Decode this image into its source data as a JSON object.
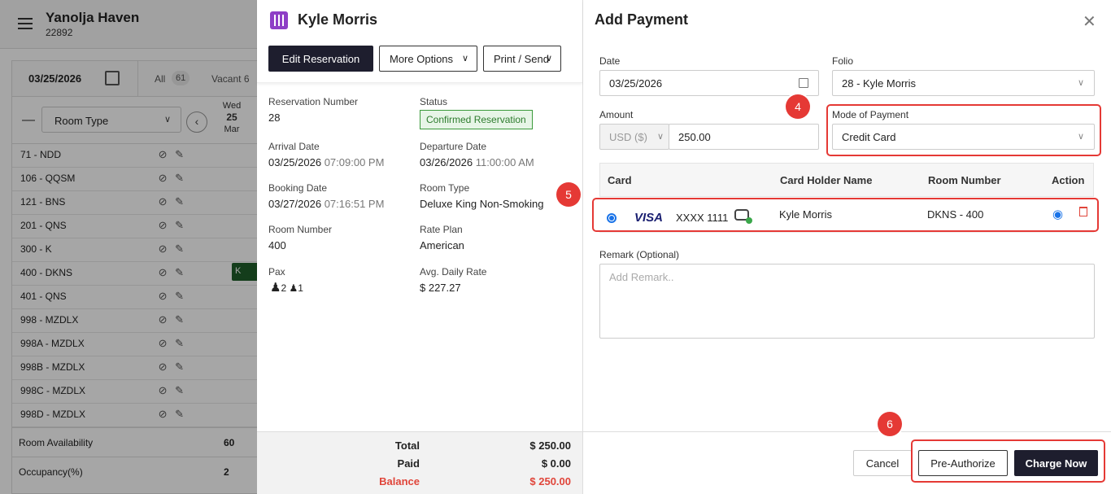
{
  "app": {
    "hotel_name": "Yanolja Haven",
    "hotel_id": "22892"
  },
  "grid": {
    "date": "03/25/2026",
    "all_label": "All",
    "all_count": "61",
    "vacant_label": "Vacant",
    "vacant_count": "6",
    "room_type_label": "Room Type",
    "day": {
      "weekday": "Wed",
      "date": "25",
      "month": "Mar"
    },
    "rooms": [
      "71 - NDD",
      "106 - QQSM",
      "121 - BNS",
      "201 - QNS",
      "300 - K",
      "400 - DKNS",
      "401 - QNS",
      "998 - MZDLX",
      "998A - MZDLX",
      "998B - MZDLX",
      "998C - MZDLX",
      "998D - MZDLX"
    ],
    "block_label": "K",
    "availability_label": "Room Availability",
    "availability_value": "60",
    "occupancy_label": "Occupancy(%)",
    "occupancy_value": "2"
  },
  "reservation": {
    "guest_name": "Kyle Morris",
    "edit_label": "Edit Reservation",
    "more_options_label": "More Options",
    "print_send_label": "Print / Send",
    "number_label": "Reservation Number",
    "number": "28",
    "status_label": "Status",
    "status": "Confirmed Reservation",
    "arrival_label": "Arrival Date",
    "arrival_date": "03/25/2026",
    "arrival_time": "07:09:00 PM",
    "departure_label": "Departure Date",
    "departure_date": "03/26/2026",
    "departure_time": "11:00:00 AM",
    "booking_label": "Booking Date",
    "booking_date": "03/27/2026",
    "booking_time": "07:16:51 PM",
    "room_type_label": "Room Type",
    "room_type": "Deluxe King Non-Smoking",
    "room_number_label": "Room Number",
    "room_number": "400",
    "rate_plan_label": "Rate Plan",
    "rate_plan": "American",
    "pax_label": "Pax",
    "adults": "2",
    "children": "1",
    "adr_label": "Avg. Daily Rate",
    "adr": "$ 227.27",
    "total_label": "Total",
    "total": "$ 250.00",
    "paid_label": "Paid",
    "paid": "$ 0.00",
    "balance_label": "Balance",
    "balance": "$ 250.00"
  },
  "payment": {
    "title": "Add Payment",
    "date_label": "Date",
    "date": "03/25/2026",
    "folio_label": "Folio",
    "folio": "28 - Kyle Morris",
    "amount_label": "Amount",
    "currency": "USD ($)",
    "amount": "250.00",
    "mode_label": "Mode of Payment",
    "mode": "Credit Card",
    "columns": {
      "card": "Card",
      "holder": "Card Holder Name",
      "room": "Room Number",
      "action": "Action"
    },
    "card": {
      "brand": "VISA",
      "number": "XXXX 1111",
      "holder": "Kyle Morris",
      "room": "DKNS - 400"
    },
    "remark_label": "Remark (Optional)",
    "remark_placeholder": "Add Remark..",
    "cancel_label": "Cancel",
    "preauth_label": "Pre-Authorize",
    "charge_label": "Charge Now"
  },
  "annotations": {
    "n4": "4",
    "n5": "5",
    "n6": "6"
  }
}
